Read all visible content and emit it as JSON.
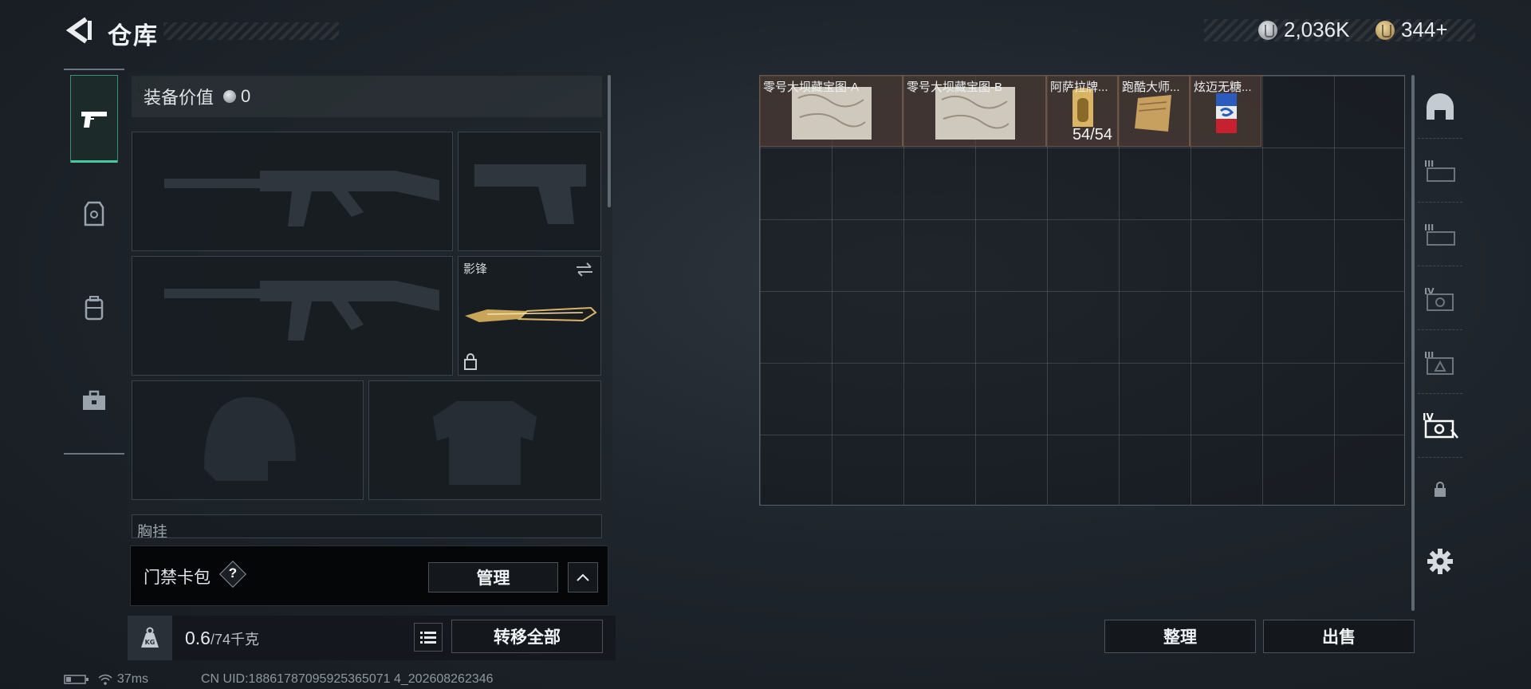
{
  "header": {
    "title": "仓库",
    "currency": [
      {
        "icon": "silver-coin-icon",
        "value": "2,036K"
      },
      {
        "icon": "gold-coin-icon",
        "value": "344+"
      }
    ]
  },
  "left_tabs": [
    {
      "icon": "pistol-icon",
      "active": true
    },
    {
      "icon": "armor-vest-icon",
      "active": false
    },
    {
      "icon": "backpack-icon",
      "active": false
    },
    {
      "icon": "toolbox-icon",
      "active": false
    }
  ],
  "equipment": {
    "value_label": "装备价值",
    "value": "0",
    "melee_label": "影锋",
    "chest_rig_label": "胸挂",
    "card_bag_label": "门禁卡包",
    "help": "?",
    "manage_button": "管理",
    "weight_value": "0.6",
    "weight_max": "/74千克",
    "transfer_all_button": "转移全部"
  },
  "storage": {
    "items": [
      {
        "name": "零号大坝藏宝图-A",
        "icon": "map-icon"
      },
      {
        "name": "零号大坝藏宝图-B",
        "icon": "map-icon"
      },
      {
        "name": "阿萨拉牌...",
        "icon": "ammo-icon",
        "count": "54/54"
      },
      {
        "name": "跑酷大师...",
        "icon": "scroll-icon"
      },
      {
        "name": "炫迈无糖...",
        "icon": "gum-pack-icon"
      }
    ],
    "sort_button": "整理",
    "sell_button": "出售"
  },
  "right_tabs": [
    {
      "icon": "dome-icon",
      "label": ""
    },
    {
      "icon": "tier-iii-backpack-icon",
      "label": "III"
    },
    {
      "icon": "tier-iii-backpack-icon",
      "label": "III"
    },
    {
      "icon": "tier-iv-case-icon",
      "label": "IV"
    },
    {
      "icon": "tier-iii-case-icon",
      "label": "III"
    },
    {
      "icon": "tier-iv-case-icon",
      "label": "IV"
    },
    {
      "icon": "lock-icon",
      "label": ""
    },
    {
      "icon": "gear-icon",
      "label": ""
    }
  ],
  "status": {
    "ping": "37ms",
    "uid": "CN UID:18861787095925365071 4_202608262346"
  }
}
